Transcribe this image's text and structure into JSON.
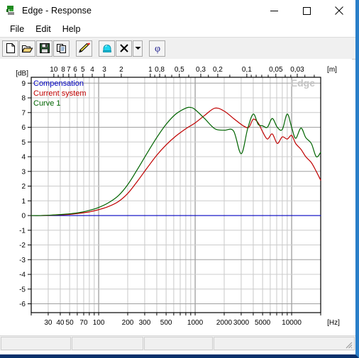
{
  "window": {
    "title": "Edge - Response",
    "icon": "edge-app-icon",
    "minimize_label": "Minimize",
    "maximize_label": "Maximize",
    "close_label": "Close"
  },
  "menu": {
    "items": [
      {
        "label": "File",
        "name": "menu-file"
      },
      {
        "label": "Edit",
        "name": "menu-edit"
      },
      {
        "label": "Help",
        "name": "menu-help"
      }
    ]
  },
  "toolbar": {
    "buttons": [
      {
        "name": "new-button",
        "icon": "new-document-icon",
        "label": "New"
      },
      {
        "name": "open-button",
        "icon": "open-folder-icon",
        "label": "Open"
      },
      {
        "name": "save-button",
        "icon": "floppy-disk-icon",
        "label": "Save"
      },
      {
        "name": "copy-button",
        "icon": "copy-icon",
        "label": "Copy"
      },
      {
        "name": "edit-curve-button",
        "icon": "pencil-icon",
        "label": "Edit curve"
      },
      {
        "name": "color-button",
        "icon": "paint-bucket-icon",
        "label": "Colour"
      },
      {
        "name": "delete-button",
        "icon": "x-cross-icon",
        "label": "Delete"
      },
      {
        "name": "delete-dropdown-button",
        "icon": "chevron-down-icon",
        "label": "Delete options"
      },
      {
        "name": "phase-button",
        "icon": "phi-icon",
        "label": "Phase"
      }
    ]
  },
  "plot": {
    "watermark": "Edge",
    "legend": [
      {
        "label": "Compensation",
        "color": "#0000c0",
        "name": "legend-compensation"
      },
      {
        "label": "Current system",
        "color": "#c00000",
        "name": "legend-current-system"
      },
      {
        "label": "Curve 1",
        "color": "#006400",
        "name": "legend-curve-1"
      }
    ]
  },
  "chart_data": {
    "type": "line",
    "title": "Edge - Response",
    "xlabel": "[Hz]",
    "ylabel": "[dB]",
    "top_axis_label": "[m]",
    "x_scale": "log",
    "xlim": [
      20,
      20000
    ],
    "ylim": [
      -6.6,
      9.4
    ],
    "grid": true,
    "legend_position": "top-left",
    "x_unit": "Hz",
    "y_unit": "dB",
    "xticks": [
      30,
      40,
      50,
      70,
      100,
      200,
      300,
      500,
      1000,
      2000,
      3000,
      5000,
      10000
    ],
    "xticklabels": [
      "30",
      "40",
      "50",
      "70",
      "100",
      "200",
      "300",
      "500",
      "1000",
      "2000",
      "3000",
      "5000",
      "10000"
    ],
    "yticks": [
      9,
      8,
      7,
      6,
      5,
      4,
      3,
      2,
      1,
      0,
      -1,
      -2,
      -3,
      -4,
      -5,
      -6
    ],
    "yticklabels": [
      "9",
      "8",
      "7",
      "6",
      "5",
      "4",
      "3",
      "2",
      "1",
      "0",
      "-1",
      "-2",
      "-3",
      "-4",
      "-5",
      "-6"
    ],
    "top_axis": {
      "label": "[m]",
      "unit": "m",
      "description": "wavelength in metres",
      "ticks": [
        10,
        8,
        7,
        6,
        5,
        4,
        3,
        2,
        1,
        0.8,
        0.5,
        0.3,
        0.2,
        0.1,
        0.05,
        0.03
      ],
      "ticklabels": [
        "10",
        "8",
        "7",
        "6",
        "5",
        "4",
        "3",
        "2",
        "1",
        "0,8",
        "0,5",
        "0,3",
        "0,2",
        "0,1",
        "0,05",
        "0,03"
      ]
    },
    "series": [
      {
        "name": "Compensation",
        "color": "#0000c0",
        "x": [
          20,
          50,
          100,
          200,
          500,
          1000,
          2000,
          5000,
          10000,
          20000
        ],
        "values": [
          0,
          0,
          0,
          0,
          0,
          0,
          0,
          0,
          0,
          0
        ]
      },
      {
        "name": "Current system",
        "color": "#c00000",
        "x": [
          20,
          25,
          32,
          40,
          50,
          63,
          80,
          100,
          125,
          160,
          200,
          250,
          315,
          400,
          500,
          630,
          800,
          1000,
          1250,
          1600,
          2000,
          2500,
          3150,
          3600,
          4000,
          4500,
          5000,
          5600,
          6300,
          7100,
          8000,
          9000,
          10000,
          11000,
          12500,
          14000,
          16000,
          18000,
          20000
        ],
        "values": [
          0.0,
          0.0,
          0.02,
          0.05,
          0.08,
          0.15,
          0.25,
          0.4,
          0.6,
          0.95,
          1.5,
          2.3,
          3.2,
          4.1,
          4.8,
          5.4,
          5.9,
          6.3,
          6.8,
          7.3,
          7.1,
          6.6,
          6.1,
          6.0,
          6.55,
          6.3,
          5.7,
          5.2,
          5.55,
          4.9,
          5.35,
          5.2,
          5.45,
          4.9,
          4.5,
          4.0,
          3.6,
          3.0,
          2.4
        ]
      },
      {
        "name": "Curve 1",
        "color": "#006400",
        "x": [
          20,
          25,
          32,
          40,
          50,
          63,
          80,
          100,
          125,
          160,
          200,
          250,
          315,
          400,
          500,
          630,
          800,
          900,
          1000,
          1250,
          1600,
          2000,
          2500,
          3000,
          3500,
          4000,
          4500,
          5000,
          5600,
          6300,
          7100,
          8000,
          9000,
          10000,
          11000,
          12500,
          14000,
          16000,
          18000,
          20000
        ],
        "values": [
          0.0,
          0.0,
          0.03,
          0.07,
          0.12,
          0.2,
          0.35,
          0.55,
          0.85,
          1.35,
          2.1,
          3.1,
          4.2,
          5.3,
          6.2,
          6.9,
          7.3,
          7.35,
          7.2,
          6.6,
          5.9,
          5.8,
          5.75,
          4.2,
          5.9,
          6.9,
          6.2,
          6.1,
          6.0,
          6.6,
          6.0,
          5.85,
          6.9,
          6.0,
          5.25,
          5.95,
          5.3,
          4.9,
          4.0,
          4.3
        ]
      }
    ]
  },
  "statusbar": {
    "panes": [
      "",
      "",
      "",
      ""
    ],
    "grip": "resize-grip"
  }
}
